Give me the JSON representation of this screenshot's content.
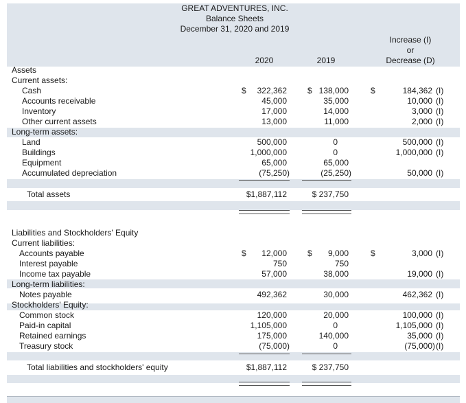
{
  "header": {
    "company": "GREAT ADVENTURES, INC.",
    "statement": "Balance Sheets",
    "date": "December 31, 2020 and 2019",
    "col_2020": "2020",
    "col_2019": "2019",
    "col_change": [
      "Increase (I)",
      "or",
      "Decrease (D)"
    ]
  },
  "sections": {
    "assets": "Assets",
    "current_assets": "Current assets:",
    "long_term_assets": "Long-term assets:",
    "liab_equity": "Liabilities and Stockholders' Equity",
    "current_liab": "Current liabilities:",
    "long_term_liab": "Long-term liabilities:",
    "equity": "Stockholders' Equity:"
  },
  "rows": {
    "cash": {
      "label": "Cash",
      "d2020": "$",
      "v2020": "322,362",
      "d2019": "$",
      "v2019": "138,000",
      "dchg": "$",
      "vchg": "184,362",
      "ind": "(I)"
    },
    "ar": {
      "label": "Accounts receivable",
      "v2020": "45,000",
      "v2019": "35,000",
      "vchg": "10,000",
      "ind": "(I)"
    },
    "inventory": {
      "label": "Inventory",
      "v2020": "17,000",
      "v2019": "14,000",
      "vchg": "3,000",
      "ind": "(I)"
    },
    "oca": {
      "label": "Other current assets",
      "v2020": "13,000",
      "v2019": "11,000",
      "vchg": "2,000",
      "ind": "(I)"
    },
    "land": {
      "label": "Land",
      "v2020": "500,000",
      "v2019": "0",
      "vchg": "500,000",
      "ind": "(I)"
    },
    "buildings": {
      "label": "Buildings",
      "v2020": "1,000,000",
      "v2019": "0",
      "vchg": "1,000,000",
      "ind": "(I)"
    },
    "equipment": {
      "label": "Equipment",
      "v2020": "65,000",
      "v2019": "65,000",
      "vchg": "",
      "ind": ""
    },
    "accum_dep": {
      "label": "Accumulated depreciation",
      "v2020": "(75,250)",
      "v2019": "(25,250)",
      "vchg": "50,000",
      "ind": "(I)"
    },
    "total_assets": {
      "label": "Total assets",
      "v2020": "$1,887,112",
      "v2019": "$ 237,750"
    },
    "ap": {
      "label": "Accounts payable",
      "d2020": "$",
      "v2020": "12,000",
      "d2019": "$",
      "v2019": "9,000",
      "dchg": "$",
      "vchg": "3,000",
      "ind": "(I)"
    },
    "int_pay": {
      "label": "Interest payable",
      "v2020": "750",
      "v2019": "750",
      "vchg": "",
      "ind": ""
    },
    "tax_pay": {
      "label": "Income tax payable",
      "v2020": "57,000",
      "v2019": "38,000",
      "vchg": "19,000",
      "ind": "(I)"
    },
    "notes_pay": {
      "label": "Notes payable",
      "v2020": "492,362",
      "v2019": "30,000",
      "vchg": "462,362",
      "ind": "(I)"
    },
    "common": {
      "label": "Common stock",
      "v2020": "120,000",
      "v2019": "20,000",
      "vchg": "100,000",
      "ind": "(I)"
    },
    "paid_in": {
      "label": "Paid-in capital",
      "v2020": "1,105,000",
      "v2019": "0",
      "vchg": "1,105,000",
      "ind": "(I)"
    },
    "retained": {
      "label": "Retained earnings",
      "v2020": "175,000",
      "v2019": "140,000",
      "vchg": "35,000",
      "ind": "(I)"
    },
    "treasury": {
      "label": "Treasury stock",
      "v2020": "(75,000)",
      "v2019": "0",
      "vchg": "(75,000)",
      "ind": "(I)"
    },
    "total_le": {
      "label": "Total liabilities and stockholders' equity",
      "v2020": "$1,887,112",
      "v2019": "$ 237,750"
    }
  },
  "colors": {
    "band": "#dfe5ec",
    "rule": "#555555",
    "text": "#1a1a1a"
  }
}
